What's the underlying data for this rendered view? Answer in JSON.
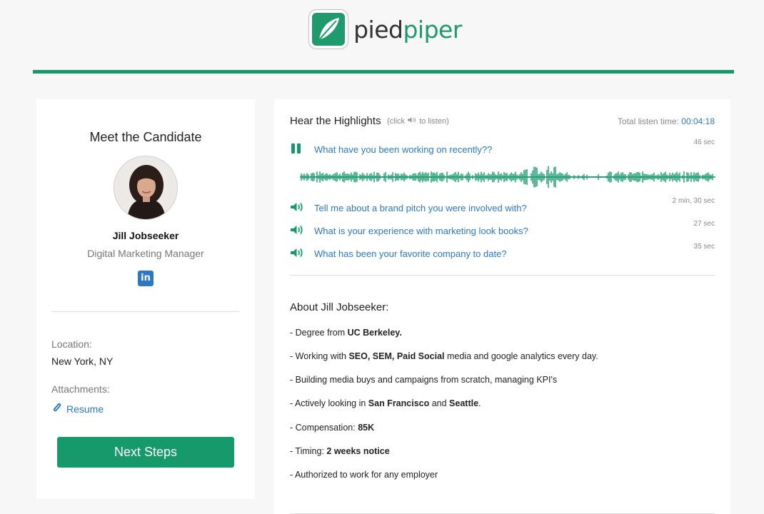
{
  "brand": {
    "logo_part1": "pied",
    "logo_part2": "piper",
    "accent_color": "#169a6c",
    "link_color": "#2b78c6"
  },
  "candidate": {
    "section_title": "Meet the Candidate",
    "name": "Jill Jobseeker",
    "role": "Digital Marketing Manager",
    "linkedin_icon_text": "in",
    "location_label": "Location:",
    "location_value": "New York, NY",
    "attachments_label": "Attachments:",
    "resume_label": "Resume",
    "next_steps_label": "Next Steps"
  },
  "highlights": {
    "title": "Hear the Highlights",
    "hint_prefix": "(click",
    "hint_suffix": "to listen)",
    "total_label": "Total listen time:",
    "total_value": "00:04:18",
    "questions": [
      {
        "text": "What have you been working on recently??",
        "duration": "46 sec",
        "state": "playing"
      },
      {
        "text": "Tell me about a brand pitch you were involved with?",
        "duration": "2 min, 30 sec",
        "state": "idle"
      },
      {
        "text": "What is your experience with marketing look books?",
        "duration": "27 sec",
        "state": "idle"
      },
      {
        "text": "What has been your favorite company to date?",
        "duration": "35 sec",
        "state": "idle"
      }
    ]
  },
  "about": {
    "title": "About Jill Jobseeker:",
    "bullets": [
      [
        {
          "t": "- Degree from "
        },
        {
          "t": "UC Berkeley.",
          "b": true
        }
      ],
      [
        {
          "t": "- Working with "
        },
        {
          "t": "SEO, SEM, Paid Social",
          "b": true
        },
        {
          "t": " media and google analytics every day."
        }
      ],
      [
        {
          "t": "- Building media buys and campaigns from scratch, managing KPI's"
        }
      ],
      [
        {
          "t": "- Actively looking in "
        },
        {
          "t": "San Francisco",
          "b": true
        },
        {
          "t": " and "
        },
        {
          "t": "Seattle",
          "b": true
        },
        {
          "t": "."
        }
      ],
      [
        {
          "t": "- Compensation: "
        },
        {
          "t": "85K",
          "b": true
        }
      ],
      [
        {
          "t": "- Timing: "
        },
        {
          "t": "2 weeks notice",
          "b": true
        }
      ],
      [
        {
          "t": "- Authorized to work for any employer"
        }
      ]
    ]
  }
}
